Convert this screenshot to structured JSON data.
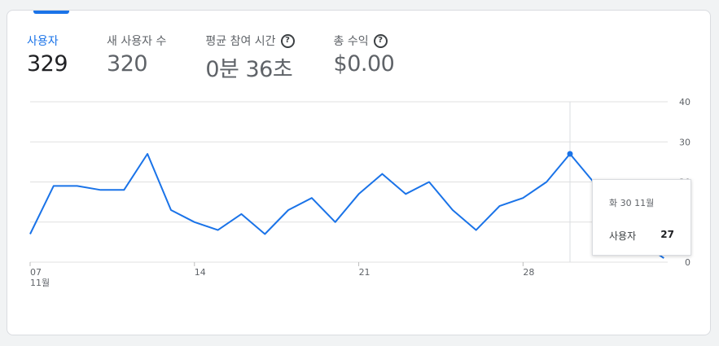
{
  "metrics": [
    {
      "label": "사용자",
      "value": "329",
      "help": false
    },
    {
      "label": "새 사용자 수",
      "value": "320",
      "help": false
    },
    {
      "label": "평균 참여 시간",
      "value": "0분 36초",
      "help": true
    },
    {
      "label": "총 수익",
      "value": "$0.00",
      "help": true
    }
  ],
  "help_glyph": "?",
  "colors": {
    "accent": "#1a73e8",
    "grid": "#e0e0e0",
    "text_secondary": "#5f6368"
  },
  "chart_data": {
    "type": "line",
    "series": [
      {
        "values": [
          7,
          19,
          19,
          18,
          18,
          27,
          13,
          10,
          8,
          12,
          7,
          13,
          16,
          10,
          17,
          22,
          17,
          20,
          13,
          8,
          14,
          16,
          20,
          27,
          20,
          13,
          5,
          1
        ]
      }
    ],
    "x_day_start": 7,
    "xticks": [
      {
        "index": 0,
        "label": "07"
      },
      {
        "index": 7,
        "label": "14"
      },
      {
        "index": 14,
        "label": "21"
      },
      {
        "index": 21,
        "label": "28"
      }
    ],
    "x_month_label": "11월",
    "ylim": [
      0,
      40
    ],
    "yticks": [
      "0",
      "10",
      "20",
      "30",
      "40"
    ],
    "grid": true,
    "highlight_index": 23
  },
  "tooltip": {
    "date": "화 30 11월",
    "series_label": "사용자",
    "value": "27"
  }
}
